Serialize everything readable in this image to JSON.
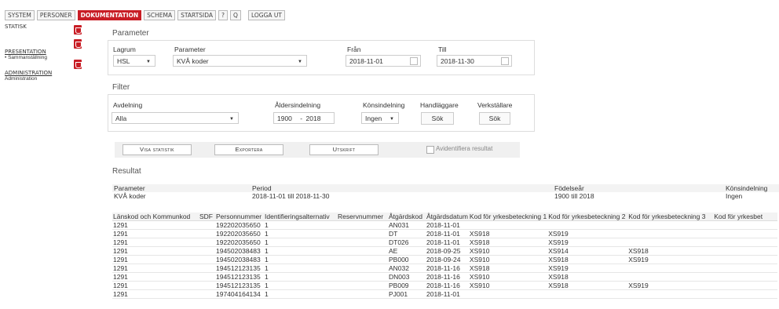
{
  "nav": {
    "items": [
      "SYSTEM",
      "PERSONER",
      "DOKUMENTATION",
      "SCHEMA",
      "STARTSIDA",
      "?",
      "Q",
      "LOGGA UT"
    ],
    "active": "DOKUMENTATION"
  },
  "sidebar": {
    "statistik": "STATISK",
    "presentation": "PRESENTATION",
    "presentation_item": "• Sammanställning",
    "administration": "ADMINISTRATION",
    "administration_item": "Administration"
  },
  "parameter": {
    "title": "Parameter",
    "lagrum_label": "Lagrum",
    "lagrum_value": "HSL",
    "parameter_label": "Parameter",
    "parameter_value": "KVÅ koder",
    "fran_label": "Från",
    "fran_value": "2018-11-01",
    "till_label": "Till",
    "till_value": "2018-11-30"
  },
  "filter": {
    "title": "Filter",
    "avdelning_label": "Avdelning",
    "avdelning_value": "Alla",
    "alder_label": "Åldersindelning",
    "alder_from": "1900",
    "alder_sep": "-",
    "alder_to": "2018",
    "kon_label": "Könsindelning",
    "kon_value": "Ingen",
    "handlaggare_label": "Handläggare",
    "handlaggare_btn": "Sök",
    "verkstallare_label": "Verkställare",
    "verkstallare_btn": "Sök"
  },
  "actions": {
    "visa": "Visa statistik",
    "exportera": "Exportera",
    "utskrift": "Utskrift",
    "avidentifiera": "Avidentifiera resultat"
  },
  "resultat": {
    "title": "Resultat",
    "meta_headers": [
      "Parameter",
      "Period",
      "Födelseår",
      "Könsindelning"
    ],
    "meta_values": [
      "KVÅ koder",
      "2018-11-01 till 2018-11-30",
      "1900 till 2018",
      "Ingen"
    ],
    "columns": [
      "Länskod och Kommunkod",
      "SDF",
      "Personnummer",
      "Identifieringsalternativ",
      "Reservnummer",
      "Åtgärdskod",
      "Åtgärdsdatum",
      "Kod för yrkesbeteckning 1",
      "Kod för yrkesbeteckning 2",
      "Kod för yrkesbeteckning 3",
      "Kod för yrkesbet"
    ],
    "rows": [
      [
        "1291",
        "",
        "192202035650",
        "1",
        "",
        "AN031",
        "2018-11-01",
        "",
        "",
        "",
        ""
      ],
      [
        "1291",
        "",
        "192202035650",
        "1",
        "",
        "DT",
        "2018-11-01",
        "XS918",
        "XS919",
        "",
        ""
      ],
      [
        "1291",
        "",
        "192202035650",
        "1",
        "",
        "DT026",
        "2018-11-01",
        "XS918",
        "XS919",
        "",
        ""
      ],
      [
        "1291",
        "",
        "194502038483",
        "1",
        "",
        "AE",
        "2018-09-25",
        "XS910",
        "XS914",
        "XS918",
        ""
      ],
      [
        "1291",
        "",
        "194502038483",
        "1",
        "",
        "PB000",
        "2018-09-24",
        "XS910",
        "XS918",
        "XS919",
        ""
      ],
      [
        "1291",
        "",
        "194512123135",
        "1",
        "",
        "AN032",
        "2018-11-16",
        "XS918",
        "XS919",
        "",
        ""
      ],
      [
        "1291",
        "",
        "194512123135",
        "1",
        "",
        "DN003",
        "2018-11-16",
        "XS910",
        "XS918",
        "",
        ""
      ],
      [
        "1291",
        "",
        "194512123135",
        "1",
        "",
        "PB009",
        "2018-11-16",
        "XS910",
        "XS918",
        "XS919",
        ""
      ],
      [
        "1291",
        "",
        "197404164134",
        "1",
        "",
        "PJ001",
        "2018-11-01",
        "",
        "",
        "",
        ""
      ]
    ]
  }
}
